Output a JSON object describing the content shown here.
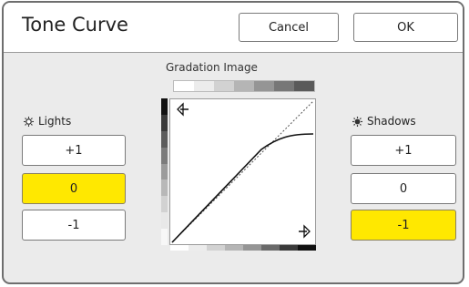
{
  "header": {
    "title": "Tone Curve",
    "cancel_label": "Cancel",
    "ok_label": "OK"
  },
  "gradation": {
    "title": "Gradation Image"
  },
  "lights": {
    "label": "Lights",
    "icon": "sun-outline-icon",
    "options": [
      "+1",
      "0",
      "-1"
    ],
    "selected": "0"
  },
  "shadows": {
    "label": "Shadows",
    "icon": "sun-filled-icon",
    "options": [
      "+1",
      "0",
      "-1"
    ],
    "selected": "-1"
  },
  "colors": {
    "selected": "#ffe800",
    "background": "#ebebeb"
  }
}
